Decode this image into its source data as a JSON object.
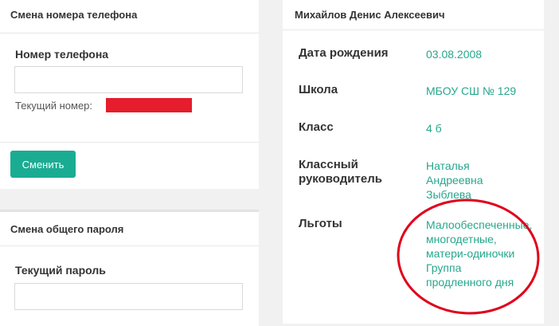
{
  "colors": {
    "accent": "#1aac93",
    "value": "#26a78c",
    "annotation": "#e0001b",
    "redaction": "#e51d2c"
  },
  "phone_card": {
    "title": "Смена номера телефона",
    "field_label": "Номер телефона",
    "field_value": "",
    "field_placeholder": "",
    "current_prefix": "Текущий номер:",
    "submit_label": "Сменить"
  },
  "password_card": {
    "title": "Смена общего пароля",
    "field_label": "Текущий пароль",
    "field_value": "",
    "field_placeholder": ""
  },
  "profile": {
    "name": "Михайлов Денис Алексеевич",
    "rows": [
      {
        "label": [
          "Дата рождения"
        ],
        "value": [
          "03.08.2008"
        ]
      },
      {
        "label": [
          "Школа"
        ],
        "value": [
          "МБОУ СШ № 129"
        ]
      },
      {
        "label": [
          "Класс"
        ],
        "value": [
          "4 б"
        ]
      },
      {
        "label": [
          "Классный",
          "руководитель"
        ],
        "value": [
          "Наталья",
          "Андреевна",
          "Зыблева"
        ]
      },
      {
        "label": [
          "Льготы"
        ],
        "value": [
          "Малообеспеченные,",
          "многодетные,",
          "матери-одиночки",
          "Группа",
          "продленного дня"
        ]
      }
    ]
  },
  "annotation": {
    "shape": "ellipse",
    "circled_field": "Льготы"
  }
}
